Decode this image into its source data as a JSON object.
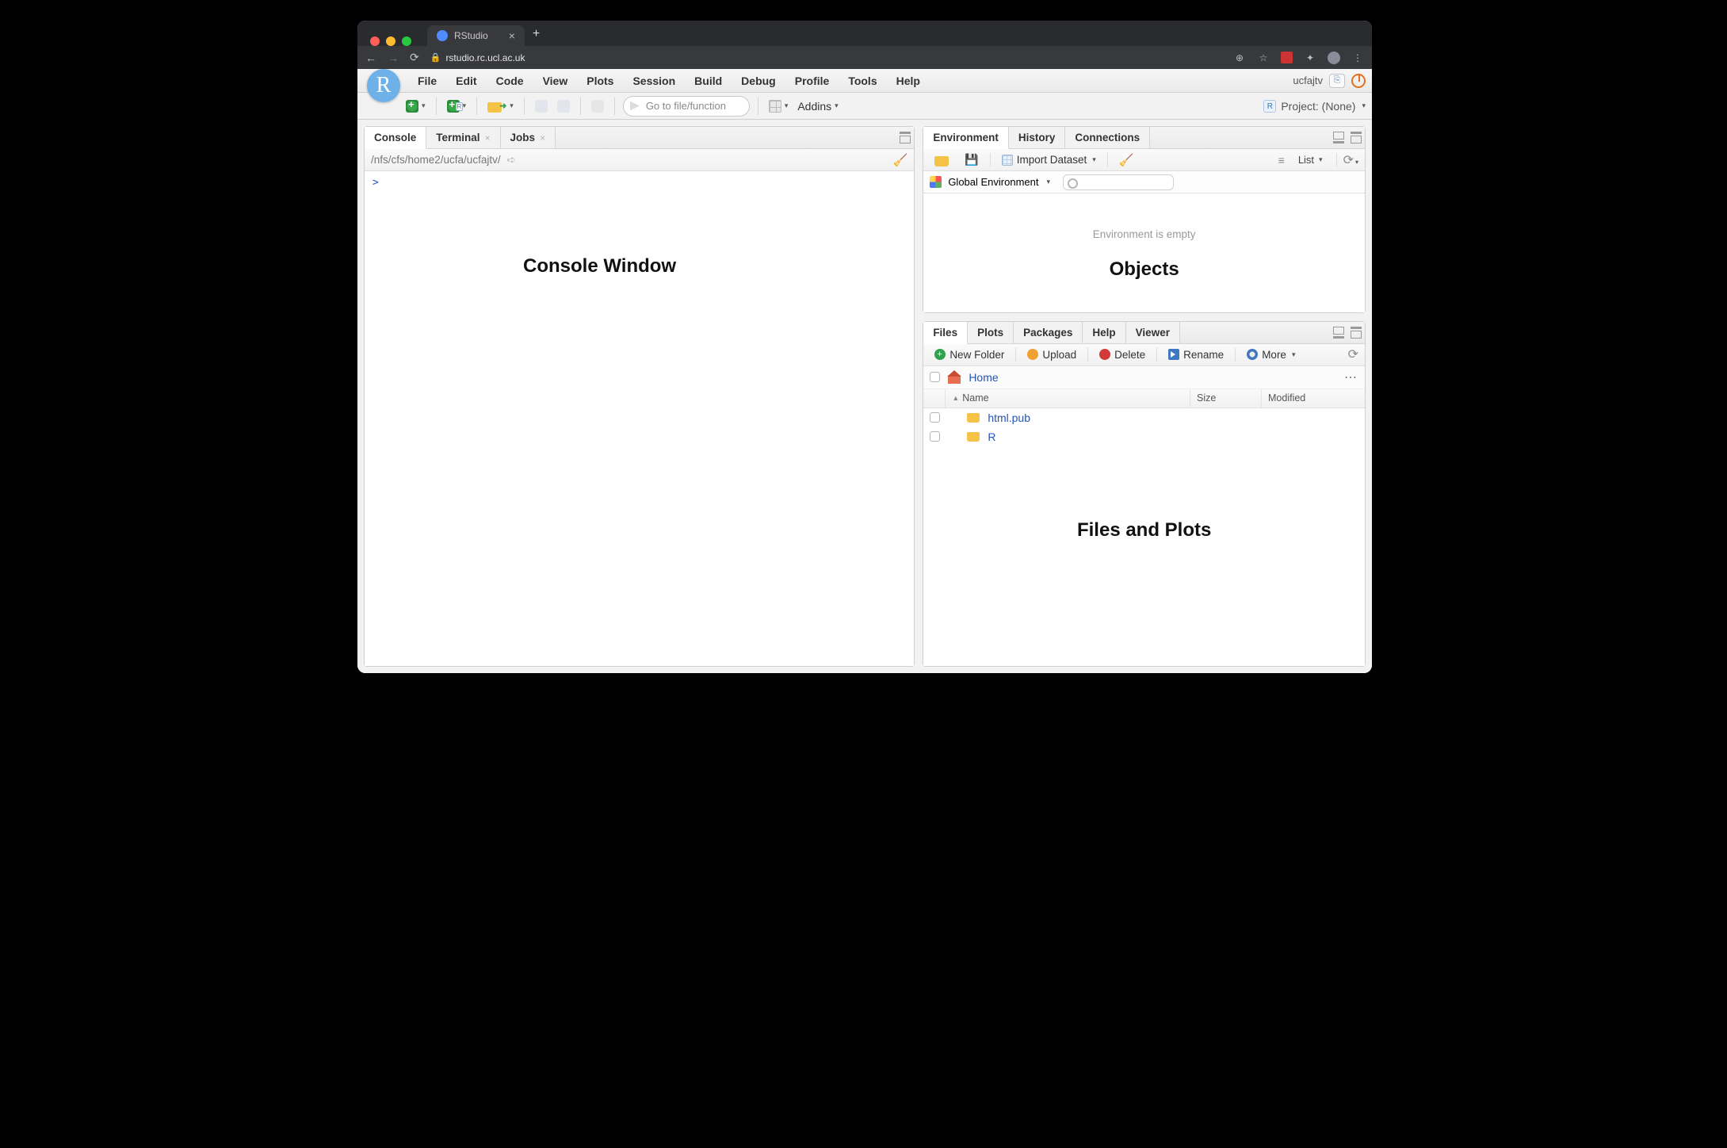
{
  "browser": {
    "tab_title": "RStudio",
    "url_host": "rstudio.rc.ucl.ac.uk"
  },
  "rstudio": {
    "menus": [
      "File",
      "Edit",
      "Code",
      "View",
      "Plots",
      "Session",
      "Build",
      "Debug",
      "Profile",
      "Tools",
      "Help"
    ],
    "user": "ucfajtv",
    "toolbar": {
      "goto_placeholder": "Go to file/function",
      "addins": "Addins",
      "project": "Project: (None)"
    },
    "console": {
      "tabs": {
        "console": "Console",
        "terminal": "Terminal",
        "jobs": "Jobs"
      },
      "wd": "/nfs/cfs/home2/ucfa/ucfajtv/",
      "prompt": ">"
    },
    "environment": {
      "tabs": {
        "env": "Environment",
        "history": "History",
        "connections": "Connections"
      },
      "import": "Import Dataset",
      "view_as": "List",
      "scope": "Global Environment",
      "empty_msg": "Environment is empty"
    },
    "files": {
      "tabs": {
        "files": "Files",
        "plots": "Plots",
        "packages": "Packages",
        "help": "Help",
        "viewer": "Viewer"
      },
      "toolbar": {
        "newfolder": "New Folder",
        "upload": "Upload",
        "delete": "Delete",
        "rename": "Rename",
        "more": "More"
      },
      "breadcrumb": "Home",
      "columns": {
        "name": "Name",
        "size": "Size",
        "modified": "Modified"
      },
      "items": [
        {
          "name": "html.pub"
        },
        {
          "name": "R"
        }
      ]
    }
  },
  "annotations": {
    "console": "Console Window",
    "objects": "Objects",
    "files": "Files and Plots"
  }
}
